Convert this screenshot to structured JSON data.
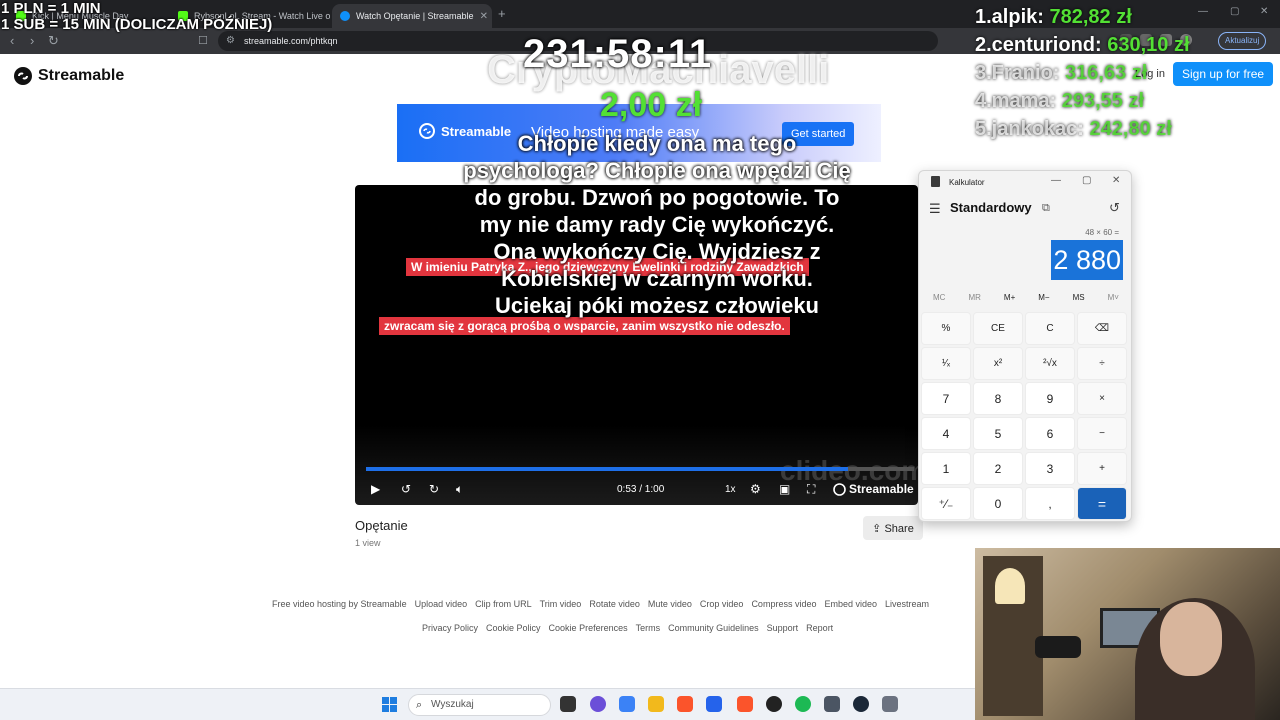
{
  "browser": {
    "tabs": [
      {
        "label": "Kick | Menu Muscle Day",
        "active": false
      },
      {
        "label": "RybsonLoL Stream - Watch Live on K",
        "active": false
      },
      {
        "label": "Watch Opętanie | Streamable",
        "active": true
      }
    ],
    "url": "streamable.com/phtkqn",
    "update_label": "Aktualizuj"
  },
  "site": {
    "logo": "Streamable",
    "login": "Log in",
    "signup": "Sign up for free",
    "banner": {
      "logo": "Streamable",
      "tagline": "Video hosting made easy",
      "cta": "Get started"
    },
    "player": {
      "caption_1": "W imieniu Patryka Z., jego dziewczyny Ewelinki i rodziny Zawadzkich",
      "caption_2": "zwracam się z gorącą prośbą o wsparcie, zanim wszystko nie odeszło.",
      "watermark": "clideo.com",
      "time": "0:53 / 1:00",
      "progress": 0.88,
      "speed": "1x",
      "brand": "Streamable"
    },
    "video": {
      "title": "Opętanie",
      "views": "1 view",
      "share": "Share"
    },
    "footer": {
      "row1": [
        "Free video hosting by Streamable",
        "Upload video",
        "Clip from URL",
        "Trim video",
        "Rotate video",
        "Mute video",
        "Crop video",
        "Compress video",
        "Embed video",
        "Livestream"
      ],
      "row2": [
        "Privacy Policy",
        "Cookie Policy",
        "Cookie Preferences",
        "Terms",
        "Community Guidelines",
        "Support",
        "Report"
      ]
    }
  },
  "overlay": {
    "rate_line_1": "1 PLN = 1 MIN",
    "rate_line_2": "1 SUB = 15 MIN (DOLICZAM PÓŹNIEJ)",
    "timer": "231:58:11",
    "donor": "CryptoMachiavelli",
    "amount": "2,00 zł",
    "message": "Chłopie kiedy ona ma tego psychologa? Chłopie ona wpędzi Cię do grobu. Dzwoń po pogotowie. To my nie damy rady Cię wykończyć. Ona wykończy Cię. Wyjdziesz z Kobielskiej w czarnym worku. Uciekaj póki możesz człowieku",
    "leaderboard": [
      {
        "name": "1.alpik:",
        "amount": "782,82 zł"
      },
      {
        "name": "2.centuriond:",
        "amount": "630,10 zł"
      },
      {
        "name": "3.Franio:",
        "amount": "316,63 zł"
      },
      {
        "name": "4.mama:",
        "amount": "293,55 zł"
      },
      {
        "name": "5.jankokac:",
        "amount": "242,80 zł"
      }
    ]
  },
  "calculator": {
    "title": "Kalkulator",
    "mode": "Standardowy",
    "expression": "48 × 60 =",
    "display": "2 880",
    "memory": [
      "MC",
      "MR",
      "M+",
      "M−",
      "MS",
      "M˅"
    ],
    "keys": [
      "%",
      "CE",
      "C",
      "⌫",
      "¹⁄ₓ",
      "x²",
      "²√x",
      "÷",
      "7",
      "8",
      "9",
      "×",
      "4",
      "5",
      "6",
      "−",
      "1",
      "2",
      "3",
      "+",
      "⁺⁄₋",
      "0",
      ",",
      "="
    ]
  },
  "taskbar": {
    "search_placeholder": "Wyszukaj"
  }
}
